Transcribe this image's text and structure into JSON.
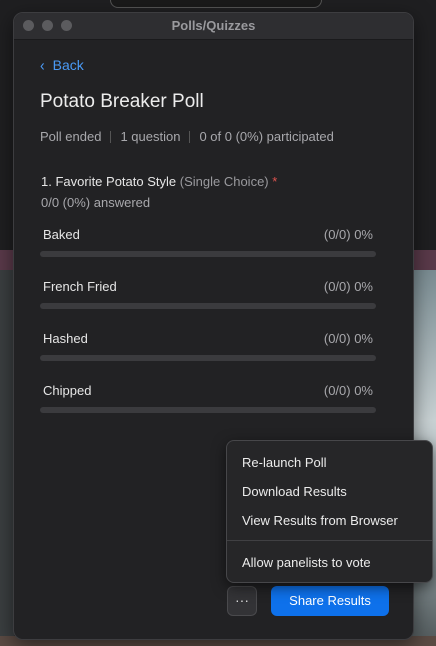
{
  "window": {
    "title": "Polls/Quizzes"
  },
  "nav": {
    "back_label": "Back",
    "back_icon": "chevron-left-icon"
  },
  "poll": {
    "title": "Potato Breaker Poll",
    "status": "Poll ended",
    "question_count": "1 question",
    "participation": "0 of 0 (0%) participated"
  },
  "question": {
    "text": "1. Favorite Potato Style",
    "type": "(Single Choice)",
    "required_marker": "*",
    "answered": "0/0 (0%) answered"
  },
  "options": [
    {
      "label": "Baked",
      "result": "(0/0) 0%",
      "fraction": 0
    },
    {
      "label": "French Fried",
      "result": "(0/0) 0%",
      "fraction": 0
    },
    {
      "label": "Hashed",
      "result": "(0/0) 0%",
      "fraction": 0
    },
    {
      "label": "Chipped",
      "result": "(0/0) 0%",
      "fraction": 0
    }
  ],
  "menu": {
    "items": [
      "Re-launch Poll",
      "Download Results",
      "View Results from Browser"
    ],
    "extra_item": "Allow panelists to vote"
  },
  "footer": {
    "more_label": "···",
    "share_label": "Share Results"
  },
  "colors": {
    "accent": "#0e71eb",
    "link": "#4a9af5",
    "required": "#e0534f"
  }
}
